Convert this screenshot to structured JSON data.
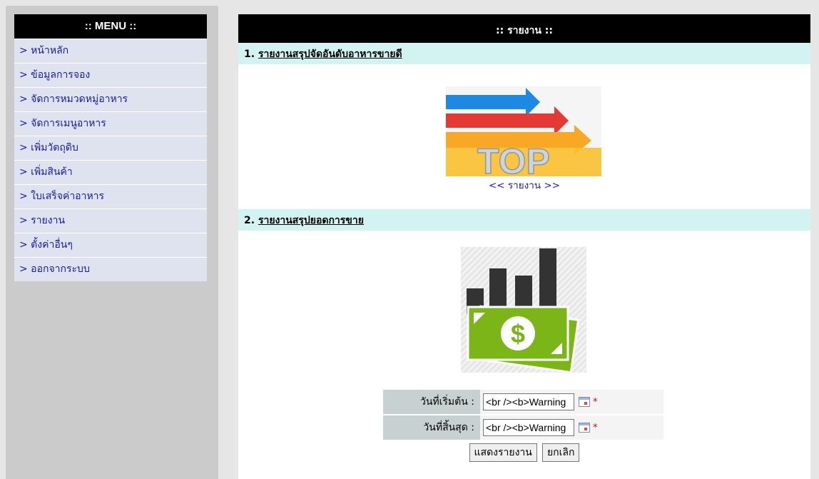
{
  "menu": {
    "header": ":: MENU ::",
    "items": [
      {
        "label": "> หน้าหลัก"
      },
      {
        "label": "> ข้อมูลการจอง"
      },
      {
        "label": "> จัดการหมวดหมู่อาหาร"
      },
      {
        "label": "> จัดการเมนูอาหาร"
      },
      {
        "label": "> เพิ่มวัตถุดิบ"
      },
      {
        "label": "> เพิ่มสินค้า"
      },
      {
        "label": "> ใบเสร็จค่าอาหาร"
      },
      {
        "label": "> รายงาน"
      },
      {
        "label": "> ตั้งค่าอื่นๆ"
      },
      {
        "label": "> ออกจากระบบ"
      }
    ]
  },
  "content": {
    "header": ":: รายงาน ::",
    "section1": {
      "number": "1.",
      "title": "รายงานสรุปจัดอันดับอาหารขายดี",
      "image_text": "TOP",
      "link": "<< รายงาน >>"
    },
    "section2": {
      "number": "2.",
      "title": "รายงานสรุปยอดการขาย",
      "start_label": "วันที่เริ่มต้น :",
      "start_value": "<br /><b>Warning",
      "end_label": "วันที่สิ้นสุด :",
      "end_value": "<br /><b>Warning",
      "required_mark": "*",
      "show_button": "แสดงรายงาน",
      "cancel_button": "ยกเลิก"
    }
  }
}
